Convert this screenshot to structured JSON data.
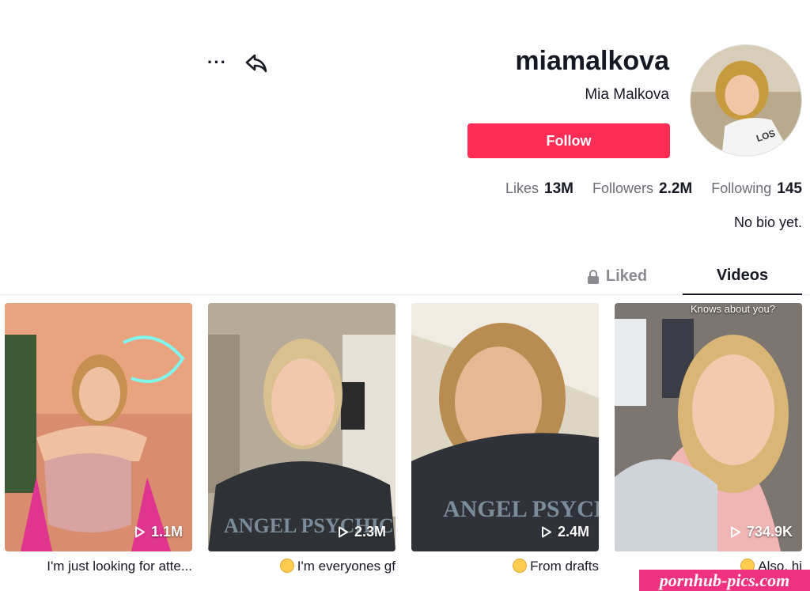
{
  "profile": {
    "username": "miamalkova",
    "display_name": "Mia Malkova",
    "follow_label": "Follow",
    "bio": "No bio yet."
  },
  "stats": {
    "following": {
      "value": "145",
      "label": "Following"
    },
    "followers": {
      "value": "2.2M",
      "label": "Followers"
    },
    "likes": {
      "value": "13M",
      "label": "Likes"
    }
  },
  "actions": {
    "more_icon": "ellipsis-icon",
    "share_icon": "share-arrow-icon"
  },
  "tabs": {
    "videos": "Videos",
    "liked": "Liked"
  },
  "videos": [
    {
      "views": "734.9K",
      "caption": "Also, hi",
      "overlay": "Knows about you?"
    },
    {
      "views": "2.4M",
      "caption": "From drafts"
    },
    {
      "views": "2.3M",
      "caption": "I'm everyones gf"
    },
    {
      "views": "1.1M",
      "caption": "I'm just looking for atte..."
    }
  ],
  "watermark": "pornhub-pics.com",
  "colors": {
    "accent": "#fe2c55",
    "watermark": "#f0317f"
  }
}
